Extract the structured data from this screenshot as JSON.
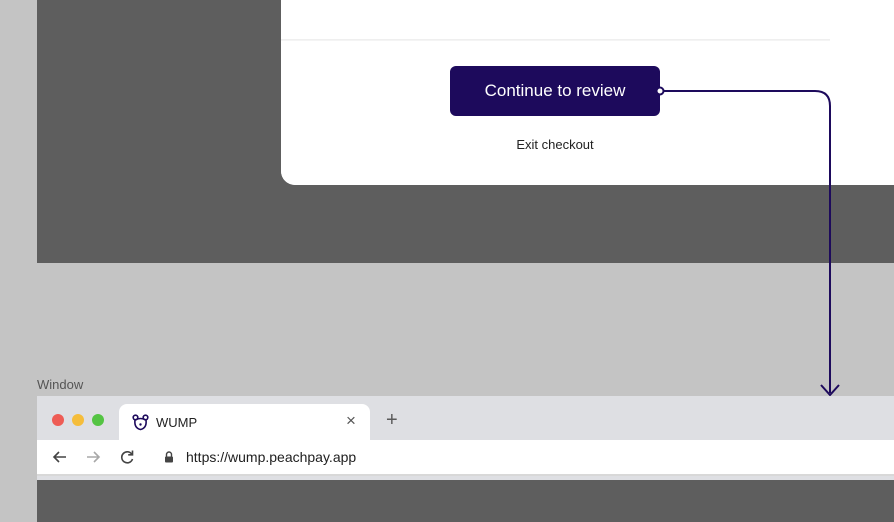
{
  "checkout": {
    "continue_label": "Continue to review",
    "exit_label": "Exit checkout"
  },
  "frame_label": "Window",
  "browser": {
    "tab_title": "WUMP",
    "tab_close": "×",
    "new_tab": "+",
    "url": "https://wump.peachpay.app"
  },
  "icons": {
    "tab_favicon": "bear-favicon-icon",
    "back": "arrow-left-icon",
    "forward": "arrow-right-icon",
    "reload": "reload-icon",
    "lock": "lock-icon"
  },
  "colors": {
    "primary_button": "#1d0a5c",
    "connector": "#1d0a5c",
    "traffic_red": "#ee5c55",
    "traffic_yellow": "#f5bd3b",
    "traffic_green": "#54c443"
  }
}
